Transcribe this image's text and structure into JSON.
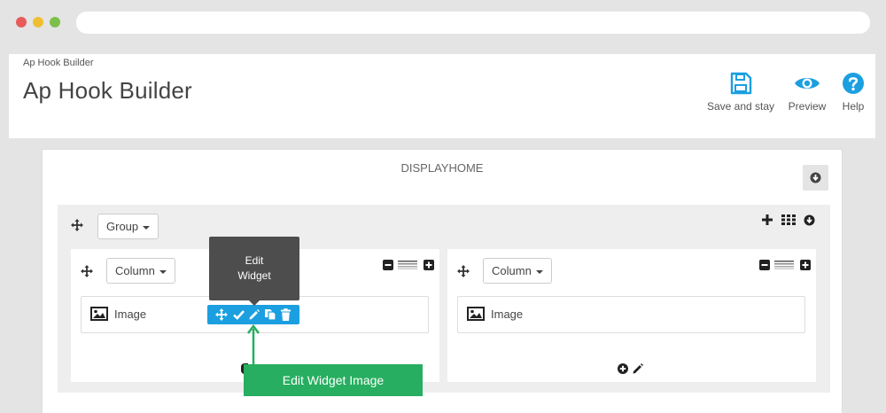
{
  "breadcrumb": "Ap Hook Builder",
  "title": "Ap Hook Builder",
  "toolbar": {
    "save_label": "Save and stay",
    "preview_label": "Preview",
    "help_label": "Help"
  },
  "hook": {
    "name": "DISPLAYHOME"
  },
  "group": {
    "dropdown_label": "Group"
  },
  "columns": [
    {
      "dropdown_label": "Column",
      "widget_label": "Image"
    },
    {
      "dropdown_label": "Column",
      "widget_label": "Image"
    }
  ],
  "tooltip": {
    "line1": "Edit",
    "line2": "Widget"
  },
  "callout": "Edit Widget Image",
  "colors": {
    "accent": "#1b9fe0",
    "callout_green": "#27ae60",
    "tooltip_bg": "#4d4d4d"
  }
}
